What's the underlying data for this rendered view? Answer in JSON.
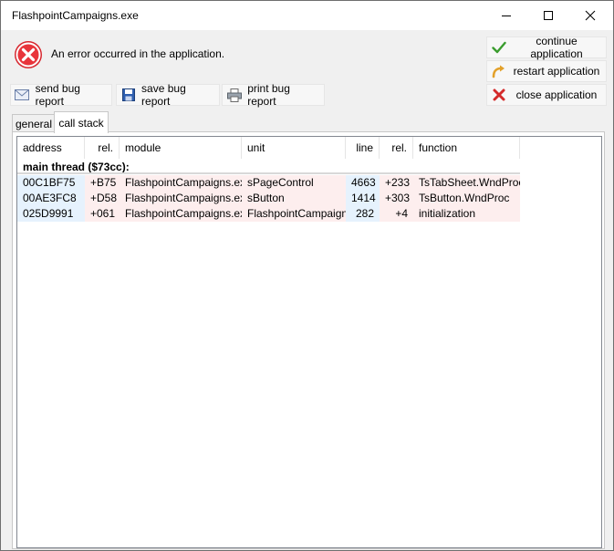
{
  "window": {
    "title": "FlashpointCampaigns.exe"
  },
  "error": {
    "message": "An error occurred in the application."
  },
  "actions": {
    "continue_label": "continue application",
    "restart_label": "restart application",
    "close_label": "close application"
  },
  "toolbar": {
    "send_label": "send bug report",
    "save_label": "save bug report",
    "print_label": "print bug report"
  },
  "tabs": {
    "general": "general",
    "call_stack": "call stack"
  },
  "table": {
    "columns": [
      "address",
      "rel.",
      "module",
      "unit",
      "line",
      "rel.",
      "function"
    ],
    "group": "main thread ($73cc):",
    "rows": [
      [
        "00C1BF75",
        "+B75",
        "FlashpointCampaigns.exe",
        "sPageControl",
        "4663",
        "+233",
        "TsTabSheet.WndProc"
      ],
      [
        "00AE3FC8",
        "+D58",
        "FlashpointCampaigns.exe",
        "sButton",
        "1414",
        "+303",
        "TsButton.WndProc"
      ],
      [
        "025D9991",
        "+061",
        "FlashpointCampaigns.exe",
        "FlashpointCampaigns",
        "282",
        "+4",
        "initialization"
      ]
    ]
  },
  "colors": {
    "row_blue": "#e6f2fd",
    "row_pink": "#fdeeee",
    "error_red": "#e8202a"
  },
  "icons": {
    "error": "error-circle-icon",
    "continue": "green-checkmark-icon",
    "restart": "curved-arrow-icon",
    "close": "red-x-icon",
    "send": "envelope-icon",
    "save": "floppy-disk-icon",
    "print": "printer-icon"
  }
}
